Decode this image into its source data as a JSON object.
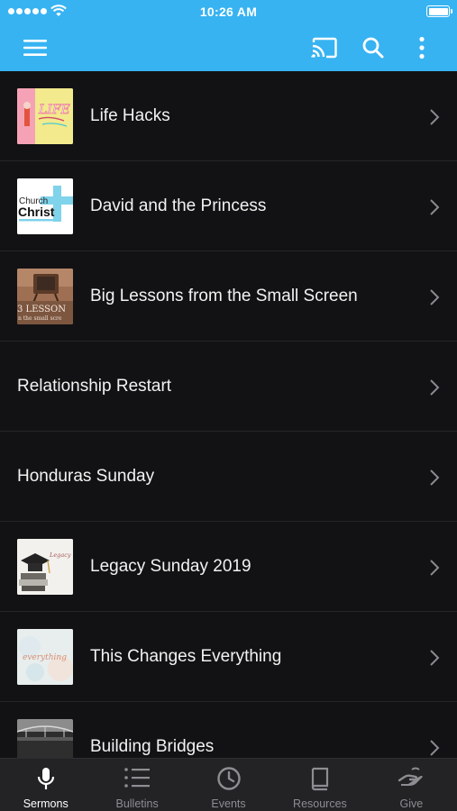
{
  "status_bar": {
    "time": "10:26 AM"
  },
  "toolbar": {
    "menu_icon": "hamburger-icon",
    "cast_icon": "cast-icon",
    "search_icon": "search-icon",
    "more_icon": "more-vertical-icon"
  },
  "sermons": [
    {
      "title": "Life Hacks",
      "thumb": "life-hacks"
    },
    {
      "title": "David and the Princess",
      "thumb": "church-christ"
    },
    {
      "title": "Big Lessons from the Small Screen",
      "thumb": "big-lessons"
    },
    {
      "title": "Relationship Restart",
      "thumb": null
    },
    {
      "title": "Honduras Sunday",
      "thumb": null
    },
    {
      "title": "Legacy Sunday 2019",
      "thumb": "legacy-sunday"
    },
    {
      "title": "This Changes Everything",
      "thumb": "changes-everything"
    },
    {
      "title": "Building Bridges",
      "thumb": "building-bridges"
    }
  ],
  "thumb_text": {
    "life_hacks": "LIFE",
    "church_line1": "Church",
    "church_line2": "Christ",
    "lessons": "3 LESSON",
    "lessons_sub": "n the small scre",
    "legacy": "Legacy Sunday 2019",
    "everything": "everything"
  },
  "tabs": [
    {
      "label": "Sermons",
      "icon": "microphone-icon",
      "active": true
    },
    {
      "label": "Bulletins",
      "icon": "list-icon",
      "active": false
    },
    {
      "label": "Events",
      "icon": "clock-icon",
      "active": false
    },
    {
      "label": "Resources",
      "icon": "book-icon",
      "active": false
    },
    {
      "label": "Give",
      "icon": "give-hand-icon",
      "active": false
    }
  ],
  "colors": {
    "accent": "#37b3f2",
    "background": "#121214",
    "tabbar": "#232326"
  }
}
